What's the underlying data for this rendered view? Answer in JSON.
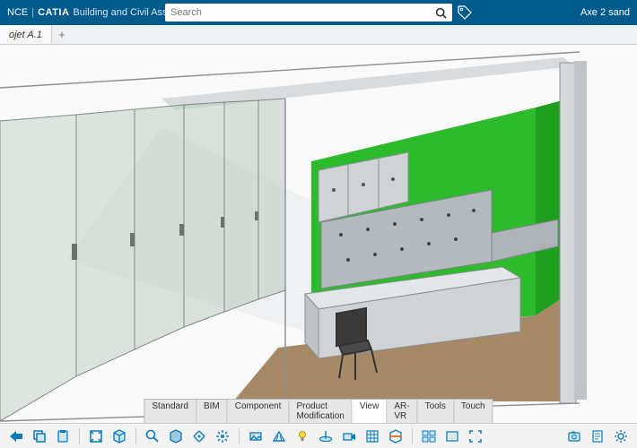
{
  "header": {
    "brand_prefix": "NCE",
    "brand_main": "CATIA",
    "brand_sub": "Building and Civil Assemblies",
    "right_text": "Axe 2 sand"
  },
  "search": {
    "placeholder": "Search"
  },
  "tabs": {
    "items": [
      {
        "label": "ojet A.1"
      }
    ]
  },
  "command_tabs": {
    "items": [
      {
        "label": "Standard",
        "active": false
      },
      {
        "label": "BIM",
        "active": false
      },
      {
        "label": "Component",
        "active": false
      },
      {
        "label": "Product Modification",
        "active": false
      },
      {
        "label": "View",
        "active": true
      },
      {
        "label": "AR-VR",
        "active": false
      },
      {
        "label": "Tools",
        "active": false
      },
      {
        "label": "Touch",
        "active": false
      }
    ]
  },
  "colors": {
    "wall_green": "#2dbb2d",
    "floor": "#a58865",
    "frame_light": "#e2e4e6",
    "frame_dark": "#9aa0a5",
    "glass": "#bccfc3",
    "toolbar_blue": "#0a7bb8",
    "brand_blue": "#005A8C"
  }
}
